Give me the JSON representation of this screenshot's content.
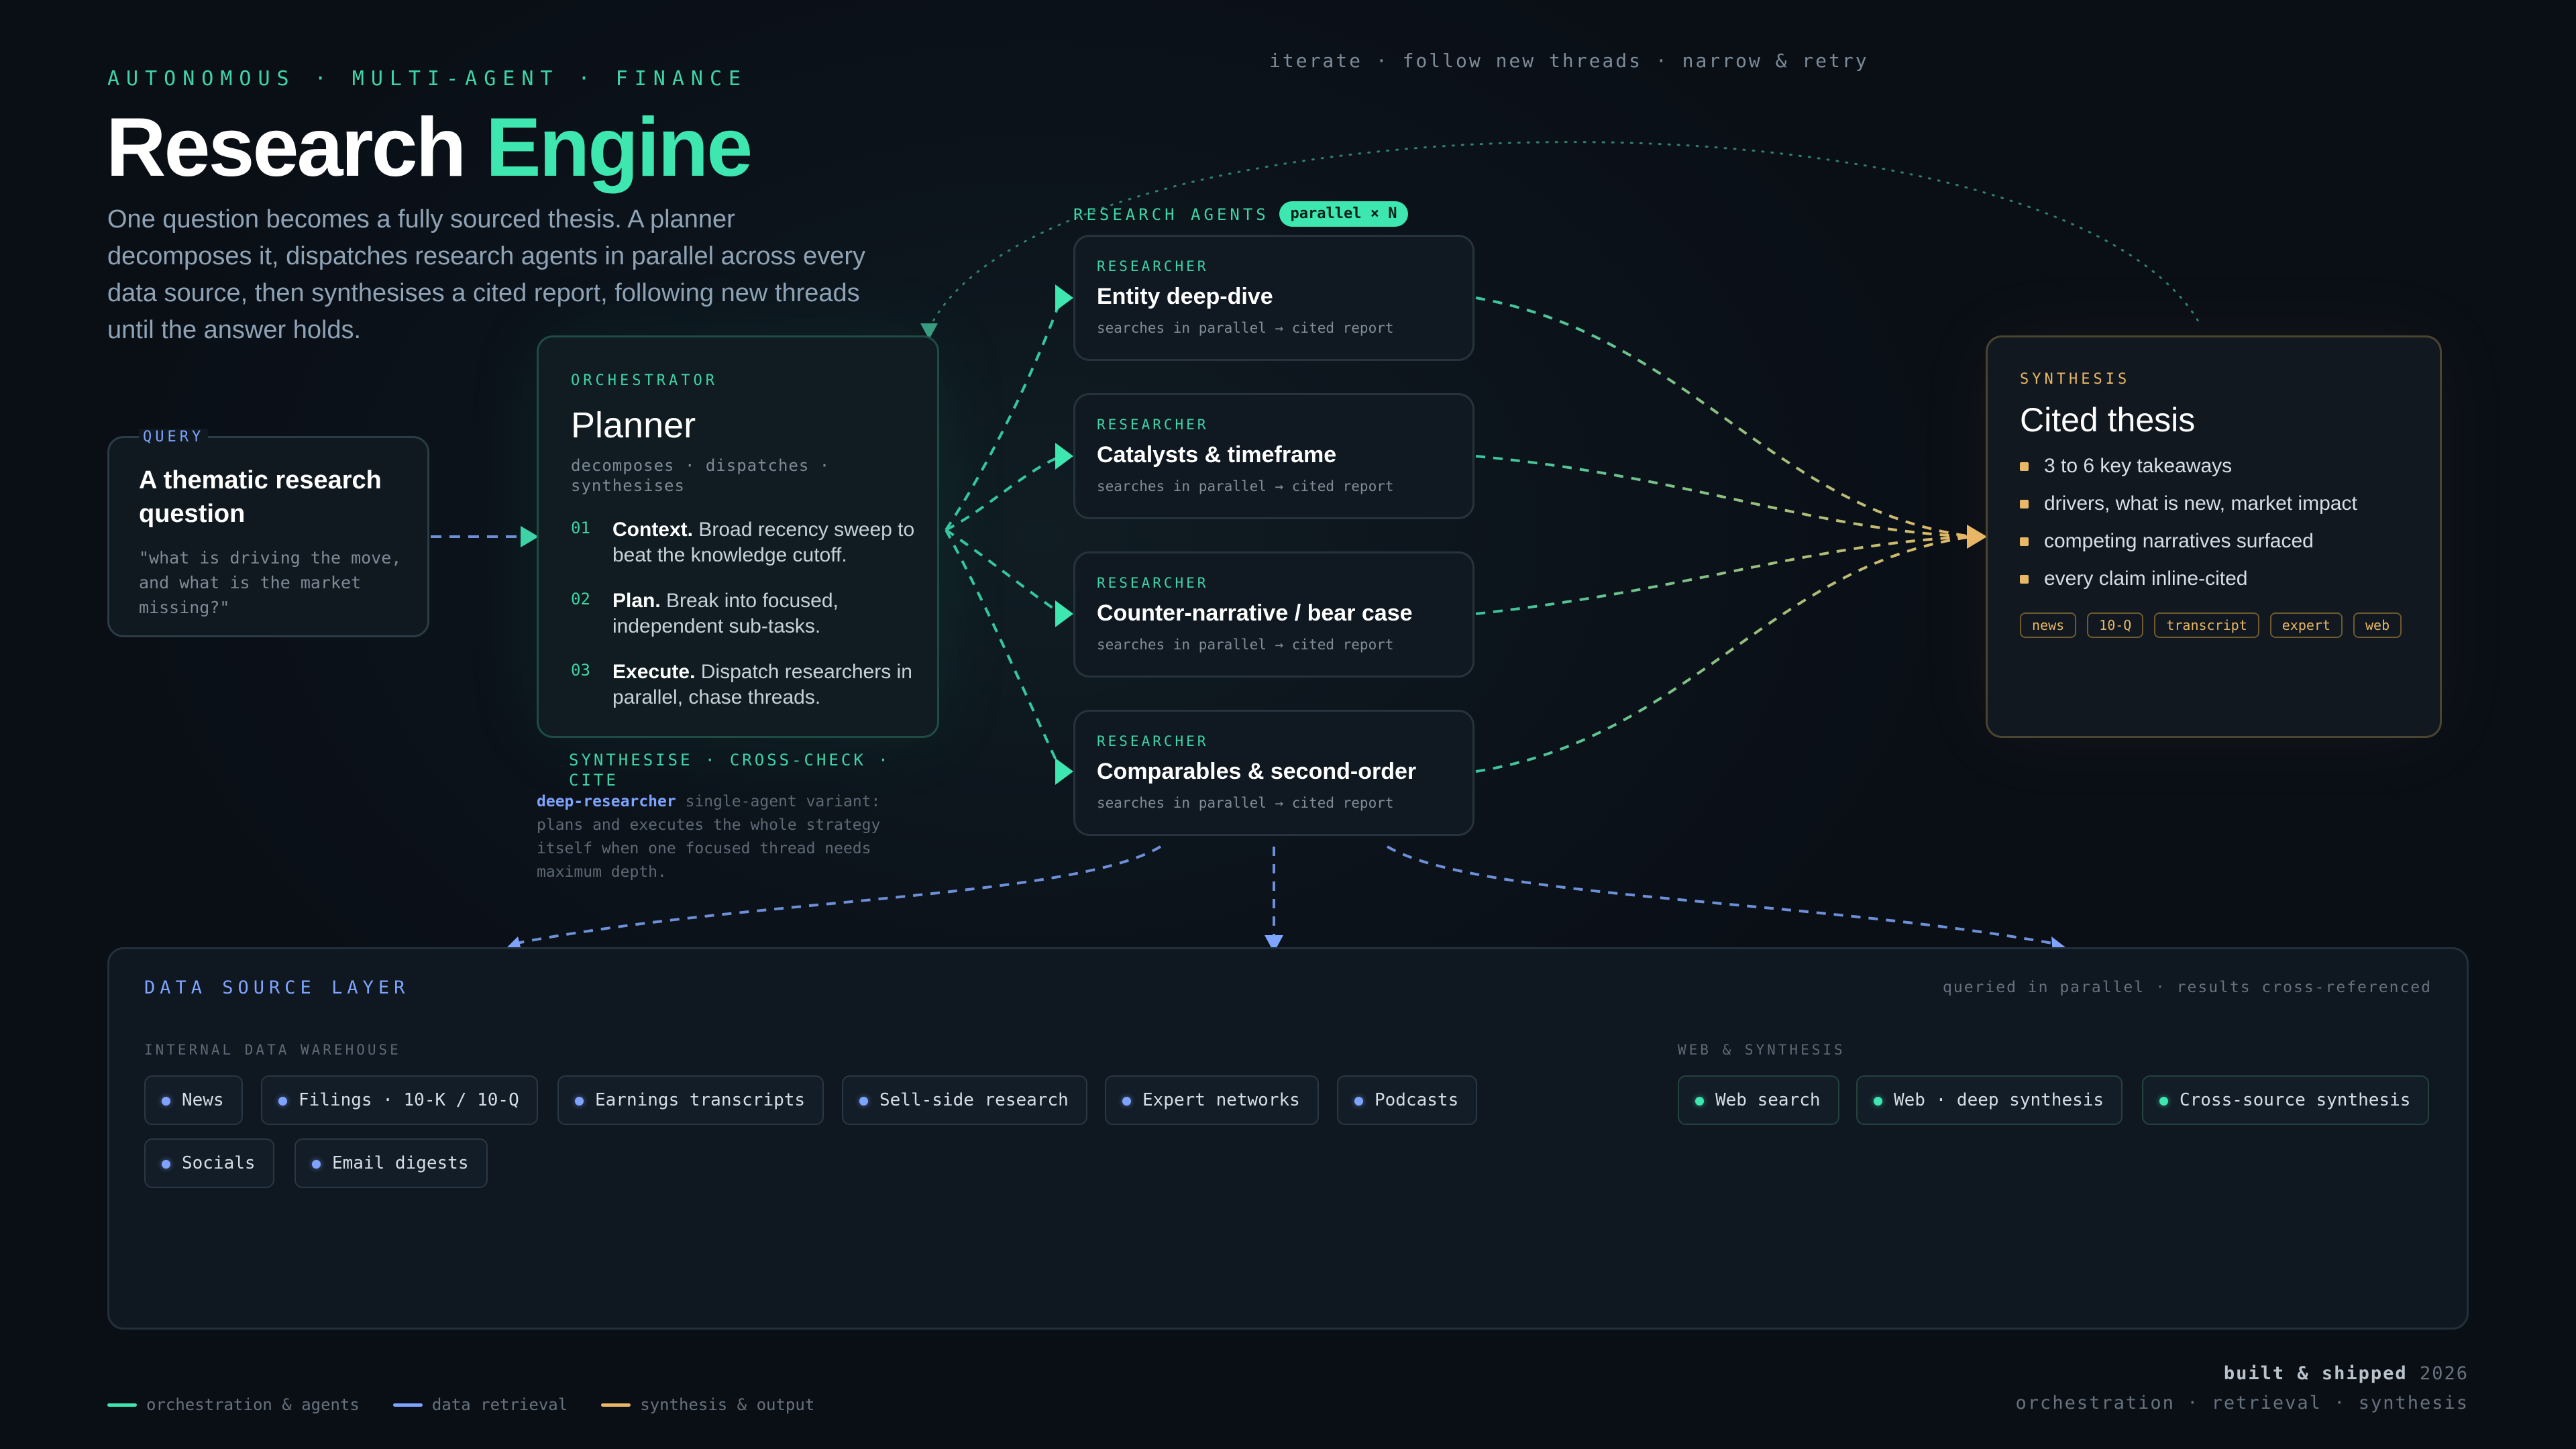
{
  "header": {
    "kicker": "AUTONOMOUS · MULTI-AGENT · FINANCE",
    "title_main": "Research",
    "title_accent": "Engine",
    "lede": "One question becomes a fully sourced thesis. A planner decomposes it, dispatches research agents in parallel across every data source, then synthesises a cited report, following new threads until the answer holds.",
    "loop_label": "iterate · follow new threads · narrow & retry"
  },
  "query": {
    "eyebrow": "QUERY",
    "title": "A thematic research question",
    "text": "\"what is driving the move,\nand what is the market missing?\""
  },
  "planner": {
    "eyebrow": "ORCHESTRATOR",
    "title": "Planner",
    "subtitle": "decomposes · dispatches · synthesises",
    "steps": [
      {
        "num": "01",
        "bold": "Context.",
        "text": " Broad recency sweep to beat the knowledge cutoff."
      },
      {
        "num": "02",
        "bold": "Plan.",
        "text": " Break into focused, independent sub-tasks."
      },
      {
        "num": "03",
        "bold": "Execute.",
        "text": " Dispatch researchers in parallel, chase threads."
      }
    ],
    "caption": "SYNTHESISE · CROSS-CHECK · CITE",
    "deep_name": "deep-researcher",
    "deep_text": " single-agent variant: plans and executes the whole strategy itself when one focused thread needs maximum depth."
  },
  "agents": {
    "label": "RESEARCH AGENTS",
    "pill": "parallel × N",
    "items": [
      {
        "eyebrow": "RESEARCHER",
        "title": "Entity deep-dive",
        "sub": "searches in parallel → cited report"
      },
      {
        "eyebrow": "RESEARCHER",
        "title": "Catalysts & timeframe",
        "sub": "searches in parallel → cited report"
      },
      {
        "eyebrow": "RESEARCHER",
        "title": "Counter-narrative / bear case",
        "sub": "searches in parallel → cited report"
      },
      {
        "eyebrow": "RESEARCHER",
        "title": "Comparables & second-order",
        "sub": "searches in parallel → cited report"
      }
    ]
  },
  "synthesis": {
    "eyebrow": "SYNTHESIS",
    "title": "Cited thesis",
    "bullets": [
      "3 to 6 key takeaways",
      "drivers, what is new, market impact",
      "competing narratives surfaced",
      "every claim inline-cited"
    ],
    "tags": [
      "news",
      "10-Q",
      "transcript",
      "expert",
      "web"
    ]
  },
  "data_layer": {
    "title": "DATA SOURCE LAYER",
    "note": "queried in parallel · results cross-referenced",
    "internal_label": "INTERNAL DATA WAREHOUSE",
    "internal": [
      "News",
      "Filings · 10-K / 10-Q",
      "Earnings transcripts",
      "Sell-side research",
      "Expert networks",
      "Podcasts",
      "Socials",
      "Email digests"
    ],
    "web_label": "WEB & SYNTHESIS",
    "web": [
      "Web search",
      "Web · deep synthesis",
      "Cross-source synthesis"
    ]
  },
  "legend": {
    "orchestration": "orchestration & agents",
    "retrieval": "data retrieval",
    "synthesis": "synthesis & output"
  },
  "credit": {
    "strong": "built & shipped",
    "year": "2026",
    "line2": "orchestration · retrieval · synthesis"
  },
  "colors": {
    "green": "#3ee6b0",
    "blue": "#7fa4ff",
    "amber": "#e8b866",
    "background": "#0b1118"
  }
}
